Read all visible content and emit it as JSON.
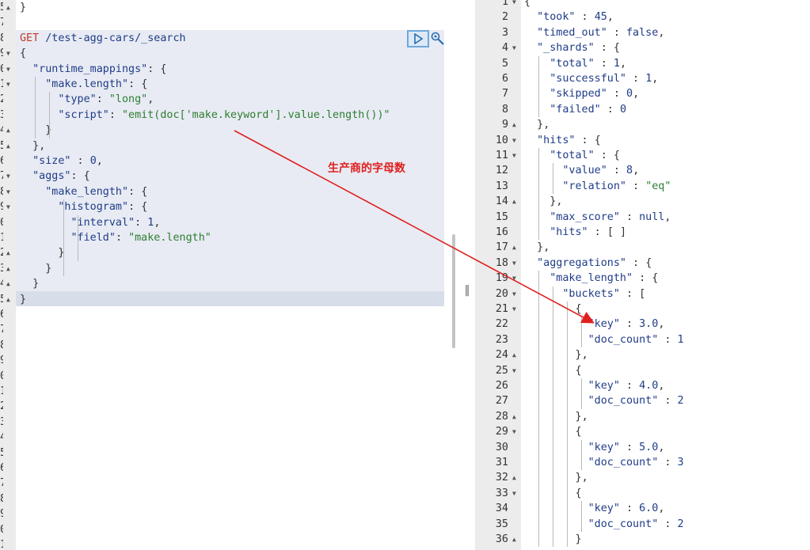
{
  "request": {
    "method": "GET",
    "path": "/test-agg-cars/_search",
    "top_lines": [
      {
        "ln": "5",
        "text": "}"
      },
      {
        "ln": "7",
        "text": ""
      }
    ],
    "gutter_numbers": [
      "5",
      "7",
      "8",
      "9",
      "0",
      "1",
      "2",
      "3",
      "4",
      "5",
      "6",
      "7",
      "8",
      "9",
      "0",
      "1",
      "2",
      "3",
      "4",
      "5",
      "6",
      "7",
      "8",
      "9",
      "0",
      "1",
      "2",
      "3",
      "4",
      "5",
      "6",
      "7",
      "8",
      "9",
      "0",
      "1"
    ],
    "lines": [
      "{",
      "  \"runtime_mappings\": {",
      "    \"make.length\": {",
      "      \"type\": \"long\",",
      "      \"script\": \"emit(doc['make.keyword'].value.length())\"",
      "    }",
      "  },",
      "  \"size\" : 0,",
      "  \"aggs\": {",
      "    \"make_length\": {",
      "      \"histogram\": {",
      "        \"interval\": 1,",
      "        \"field\": \"make.length\"",
      "      }",
      "    }",
      "  }",
      "}"
    ]
  },
  "annotation": {
    "text": "生产商的字母数",
    "color": "#e02020"
  },
  "response": {
    "line_numbers": [
      "1",
      "2",
      "3",
      "4",
      "5",
      "6",
      "7",
      "8",
      "9",
      "10",
      "11",
      "12",
      "13",
      "14",
      "15",
      "16",
      "17",
      "18",
      "19",
      "20",
      "21",
      "22",
      "23",
      "24",
      "25",
      "26",
      "27",
      "28",
      "29",
      "30",
      "31",
      "32",
      "33",
      "34",
      "35",
      "36"
    ],
    "lines": [
      "{",
      "  \"took\" : 45,",
      "  \"timed_out\" : false,",
      "  \"_shards\" : {",
      "    \"total\" : 1,",
      "    \"successful\" : 1,",
      "    \"skipped\" : 0,",
      "    \"failed\" : 0",
      "  },",
      "  \"hits\" : {",
      "    \"total\" : {",
      "      \"value\" : 8,",
      "      \"relation\" : \"eq\"",
      "    },",
      "    \"max_score\" : null,",
      "    \"hits\" : [ ]",
      "  },",
      "  \"aggregations\" : {",
      "    \"make_length\" : {",
      "      \"buckets\" : [",
      "        {",
      "          \"key\" : 3.0,",
      "          \"doc_count\" : 1",
      "        },",
      "        {",
      "          \"key\" : 4.0,",
      "          \"doc_count\" : 2",
      "        },",
      "        {",
      "          \"key\" : 5.0,",
      "          \"doc_count\" : 3",
      "        },",
      "        {",
      "          \"key\" : 6.0,",
      "          \"doc_count\" : 2",
      "        }"
    ]
  },
  "colors": {
    "method": "#c0392b",
    "key": "#1f3c88",
    "string": "#2e7d32",
    "request_bg": "#e8ebf3",
    "arrow": "#e02020"
  },
  "icons": {
    "run": "play-icon",
    "settings": "wrench-icon",
    "resize": "resize-handle-icon"
  }
}
